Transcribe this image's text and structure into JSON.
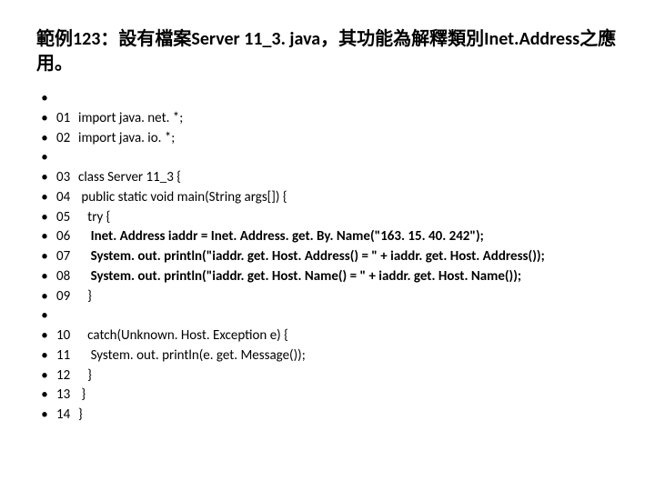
{
  "title": "範例123：設有檔案Server 11_3. java，其功能為解釋類別Inet.Address之應用。",
  "lines": [
    {
      "lineno": "",
      "code": "",
      "bold": false
    },
    {
      "lineno": "01",
      "code": "import java. net. *;",
      "bold": false
    },
    {
      "lineno": "02",
      "code": "import java. io. *;",
      "bold": false
    },
    {
      "lineno": "",
      "code": "",
      "bold": false
    },
    {
      "lineno": "03",
      "code": "class Server 11_3 {",
      "bold": false
    },
    {
      "lineno": "04",
      "code": " public static void main(String args[]) {",
      "bold": false
    },
    {
      "lineno": "05",
      "code": "   try {",
      "bold": false
    },
    {
      "lineno": "06",
      "code": "    Inet. Address iaddr = Inet. Address. get. By. Name(\"163. 15. 40. 242\");",
      "bold": true
    },
    {
      "lineno": "07",
      "code": "    System. out. println(\"iaddr. get. Host. Address() = \" + iaddr. get. Host. Address());",
      "bold": true
    },
    {
      "lineno": "08",
      "code": "    System. out. println(\"iaddr. get. Host. Name() = \" + iaddr. get. Host. Name());",
      "bold": true
    },
    {
      "lineno": "09",
      "code": "   }",
      "bold": false
    },
    {
      "lineno": "",
      "code": "",
      "bold": false
    },
    {
      "lineno": "10",
      "code": "   catch(Unknown. Host. Exception e) {",
      "bold": false
    },
    {
      "lineno": "11",
      "code": "    System. out. println(e. get. Message());",
      "bold": false
    },
    {
      "lineno": "12",
      "code": "   }",
      "bold": false
    },
    {
      "lineno": "13",
      "code": " }",
      "bold": false
    },
    {
      "lineno": "14",
      "code": "}",
      "bold": false
    }
  ]
}
